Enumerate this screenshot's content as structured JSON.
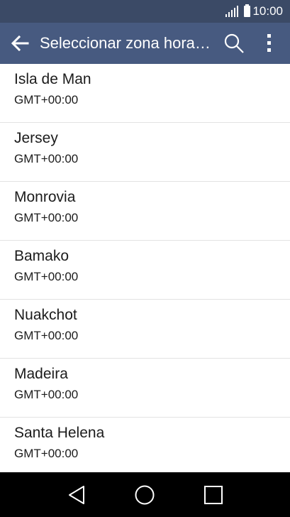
{
  "status_bar": {
    "time": "10:00",
    "signal_icon": "signal-icon",
    "battery_icon": "battery-icon"
  },
  "app_bar": {
    "title": "Seleccionar zona hora…",
    "back_icon": "arrow-left-icon",
    "search_icon": "search-icon",
    "menu_icon": "more-vert-icon",
    "background": "#475a80"
  },
  "timezones": [
    {
      "name": "Isla de Man",
      "offset": "GMT+00:00"
    },
    {
      "name": "Jersey",
      "offset": "GMT+00:00"
    },
    {
      "name": "Monrovia",
      "offset": "GMT+00:00"
    },
    {
      "name": "Bamako",
      "offset": "GMT+00:00"
    },
    {
      "name": "Nuakchot",
      "offset": "GMT+00:00"
    },
    {
      "name": "Madeira",
      "offset": "GMT+00:00"
    },
    {
      "name": "Santa Helena",
      "offset": "GMT+00:00"
    }
  ],
  "nav_bar": {
    "back_icon": "nav-back-triangle-icon",
    "home_icon": "nav-home-circle-icon",
    "recents_icon": "nav-recents-square-icon"
  }
}
